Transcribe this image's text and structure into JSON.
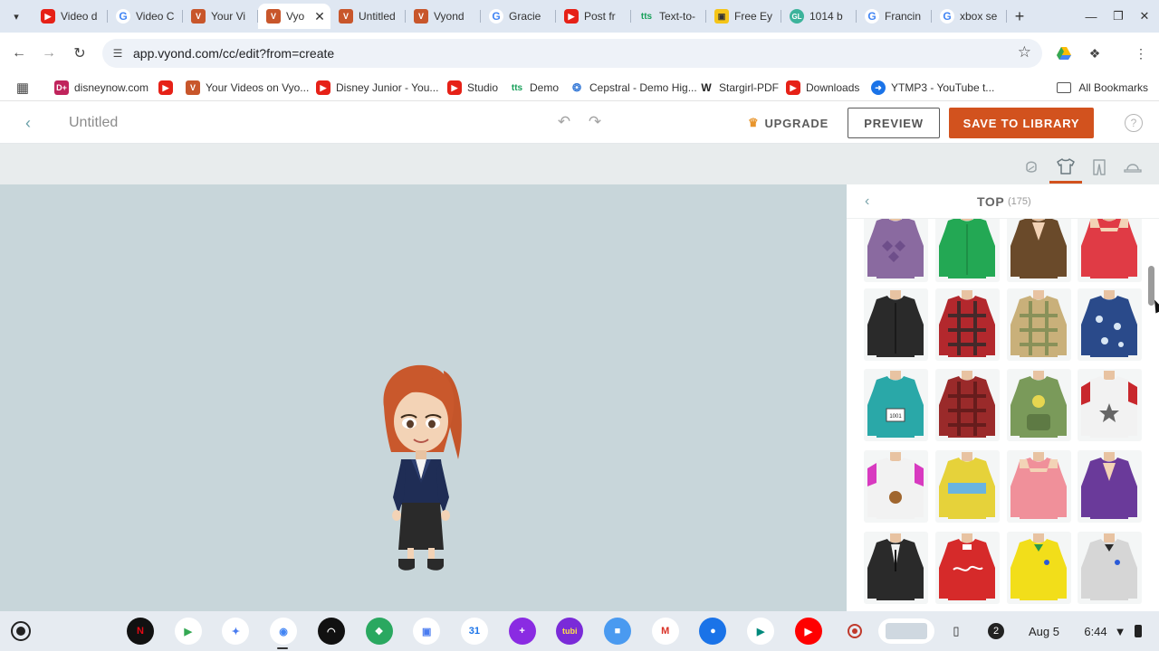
{
  "browser": {
    "tabs": [
      {
        "label": "Video d",
        "icon": "youtube-icon",
        "active": false
      },
      {
        "label": "Video C",
        "icon": "google-icon",
        "active": false
      },
      {
        "label": "Your Vi",
        "icon": "vyond-icon",
        "active": false
      },
      {
        "label": "Vyo",
        "icon": "vyond-icon",
        "active": true
      },
      {
        "label": "Untitled",
        "icon": "vyond-icon",
        "active": false
      },
      {
        "label": "Vyond",
        "icon": "vyond-icon",
        "active": false
      },
      {
        "label": "Gracie",
        "icon": "google-icon",
        "active": false
      },
      {
        "label": "Post fr",
        "icon": "youtube-icon",
        "active": false
      },
      {
        "label": "Text-to-",
        "icon": "tts-icon",
        "active": false
      },
      {
        "label": "Free Ey",
        "icon": "camera-icon",
        "active": false
      },
      {
        "label": "1014 b",
        "icon": "gl-icon",
        "active": false
      },
      {
        "label": "Francin",
        "icon": "google-icon",
        "active": false
      },
      {
        "label": "xbox se",
        "icon": "google-icon",
        "active": false
      }
    ],
    "url": "app.vyond.com/cc/edit?from=create",
    "bookmarks": [
      {
        "label": "disneynow.com",
        "icon": "disney-icon"
      },
      {
        "label": "",
        "icon": "youtube-icon"
      },
      {
        "label": "Your Videos on Vyo...",
        "icon": "vyond-icon"
      },
      {
        "label": "Disney Junior - You...",
        "icon": "youtube-icon"
      },
      {
        "label": "Studio",
        "icon": "youtube-icon"
      },
      {
        "label": "Demo",
        "icon": "tts-icon"
      },
      {
        "label": "Cepstral - Demo Hig...",
        "icon": "cepstral-icon"
      },
      {
        "label": "Stargirl-PDF",
        "icon": "w-icon"
      },
      {
        "label": "Downloads",
        "icon": "youtube-icon"
      },
      {
        "label": "YTMP3 - YouTube t...",
        "icon": "ytmp3-icon"
      }
    ],
    "all_bookmarks": "All Bookmarks"
  },
  "app": {
    "title": "Untitled",
    "upgrade": "UPGRADE",
    "preview": "PREVIEW",
    "save": "SAVE TO LIBRARY",
    "help": "?",
    "accent_color": "#d2521e"
  },
  "panel": {
    "title": "TOP",
    "count": "(175)",
    "items": [
      {
        "name": "purple-argyle-vest",
        "body": "#8a6aa0",
        "color": "#6e4e8a",
        "pattern": "argyle"
      },
      {
        "name": "green-zip-hoodie",
        "body": "#23a854",
        "color": "#1d8f46",
        "pattern": "zip"
      },
      {
        "name": "brown-cardigan",
        "body": "#6a4a2a",
        "color": "#5a3d22",
        "pattern": "v"
      },
      {
        "name": "red-tank-top",
        "body": "#e03b45",
        "color": "#c82d38",
        "pattern": "tank"
      },
      {
        "name": "black-leather-jacket",
        "body": "#2a2a2a",
        "color": "#1a1a1a",
        "pattern": "zip"
      },
      {
        "name": "red-plaid-shirt",
        "body": "#b3282d",
        "color": "#2a2a2a",
        "pattern": "plaid"
      },
      {
        "name": "tan-plaid-backpack-shirt",
        "body": "#c9b07a",
        "color": "#7a8a52",
        "pattern": "plaid"
      },
      {
        "name": "blue-hawaiian-shirt",
        "body": "#2a4a8a",
        "color": "#d8e6f4",
        "pattern": "floral"
      },
      {
        "name": "teal-runner-tank",
        "body": "#2aa8a8",
        "color": "#1e8a8a",
        "pattern": "bib"
      },
      {
        "name": "red-flannel-shirt",
        "body": "#9a2a2a",
        "color": "#5a1a1a",
        "pattern": "plaid"
      },
      {
        "name": "green-backpack",
        "body": "#7a9a5a",
        "color": "#e6d650",
        "pattern": "bag"
      },
      {
        "name": "red-star-raglan",
        "body": "#f2f2f2",
        "color": "#c8282d",
        "pattern": "star"
      },
      {
        "name": "pink-bear-raglan",
        "body": "#f2f2f2",
        "color": "#d83ac0",
        "pattern": "bear"
      },
      {
        "name": "yellow-stripe-sweater",
        "body": "#e6d23a",
        "color": "#6ab4e0",
        "pattern": "stripe"
      },
      {
        "name": "pink-halter-top",
        "body": "#f0909a",
        "color": "#e6c07a",
        "pattern": "tank"
      },
      {
        "name": "purple-vest",
        "body": "#6a3a9a",
        "color": "#4e2a7a",
        "pattern": "v"
      },
      {
        "name": "black-suit-jacket",
        "body": "#2a2a2a",
        "color": "#f2f2f2",
        "pattern": "suit"
      },
      {
        "name": "red-football-jersey",
        "body": "#d62a2a",
        "color": "#ffffff",
        "pattern": "script"
      },
      {
        "name": "yellow-brazil-jersey",
        "body": "#f2de1a",
        "color": "#2a9a4a",
        "pattern": "badge"
      },
      {
        "name": "gray-polo-shirt",
        "body": "#d6d6d6",
        "color": "#2a2a2a",
        "pattern": "badge"
      }
    ]
  },
  "shelf": {
    "apps": [
      "netflix-icon",
      "play-store-icon",
      "gemini-icon",
      "chrome-icon",
      "audible-icon",
      "apps-icon",
      "photo-icon",
      "calendar-icon",
      "plus-icon",
      "tubi-icon",
      "files-icon",
      "gmail-icon",
      "messages-icon",
      "meet-icon",
      "youtube-icon"
    ],
    "notification_count": "2",
    "date": "Aug 5",
    "time": "6:44"
  }
}
